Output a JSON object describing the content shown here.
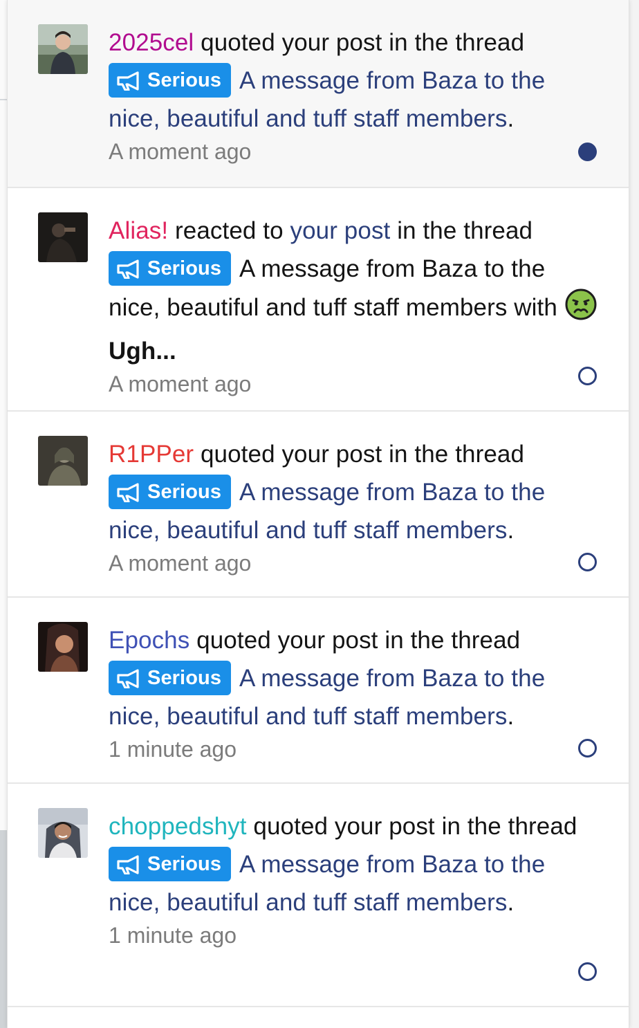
{
  "colors": {
    "link": "#2b3f7b",
    "badge_bg": "#1a8fe8",
    "timestamp": "#7b7b7b",
    "unread_bg": "#f7f7f7"
  },
  "notifications": [
    {
      "username": "2025cel",
      "username_color": "#b10c8f",
      "action": "quoted your post in the thread",
      "prefix": "Serious",
      "thread_title": "A message from Baza to the nice, beautiful and tuff staff members",
      "period": ".",
      "time": "A moment ago",
      "unread": true,
      "avatar_icon": "user-avatar-photo"
    },
    {
      "username": "Alias!",
      "username_color": "#e0245e",
      "action_pre": "reacted to",
      "action_link": "your post",
      "action_post": "in the thread",
      "prefix": "Serious",
      "thread_title": "A message from Baza to the nice, beautiful and tuff staff members",
      "with_label": "with",
      "reaction_icon": "nauseated-face-icon",
      "reaction_name": "Ugh...",
      "time": "A moment ago",
      "unread": false,
      "avatar_icon": "user-avatar-photo"
    },
    {
      "username": "R1PPer",
      "username_color": "#e53935",
      "action": "quoted your post in the thread",
      "prefix": "Serious",
      "thread_title": "A message from Baza to the nice, beautiful and tuff staff members",
      "period": ".",
      "time": "A moment ago",
      "unread": false,
      "avatar_icon": "user-avatar-photo"
    },
    {
      "username": "Epochs",
      "username_color": "#3f51b5",
      "action": "quoted your post in the thread",
      "prefix": "Serious",
      "thread_title": "A message from Baza to the nice, beautiful and tuff staff members",
      "period": ".",
      "time": "1 minute ago",
      "unread": false,
      "avatar_icon": "user-avatar-photo"
    },
    {
      "username": "choppedshyt",
      "username_color": "#1fb5bd",
      "action": "quoted your post in the thread",
      "prefix": "Serious",
      "thread_title": "A message from Baza to the nice, beautiful and tuff staff members",
      "period": ".",
      "time": "1 minute ago",
      "unread": false,
      "avatar_icon": "user-avatar-photo"
    }
  ]
}
